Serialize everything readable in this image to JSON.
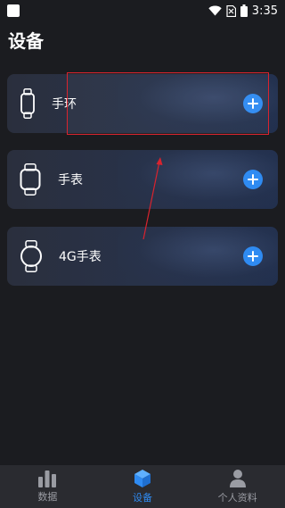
{
  "status_bar": {
    "time": "3:35"
  },
  "page": {
    "title": "设备"
  },
  "devices": [
    {
      "label": "手环",
      "icon": "band-icon"
    },
    {
      "label": "手表",
      "icon": "watch-icon"
    },
    {
      "label": "4G手表",
      "icon": "round-watch-icon"
    }
  ],
  "bottom_nav": {
    "items": [
      {
        "label": "数据",
        "icon": "bar-chart-icon",
        "active": false
      },
      {
        "label": "设备",
        "icon": "cube-icon",
        "active": true
      },
      {
        "label": "个人资料",
        "icon": "person-icon",
        "active": false
      }
    ]
  },
  "colors": {
    "accent": "#2f8bf2",
    "background": "#1b1c20",
    "annotation": "#d9232e"
  }
}
